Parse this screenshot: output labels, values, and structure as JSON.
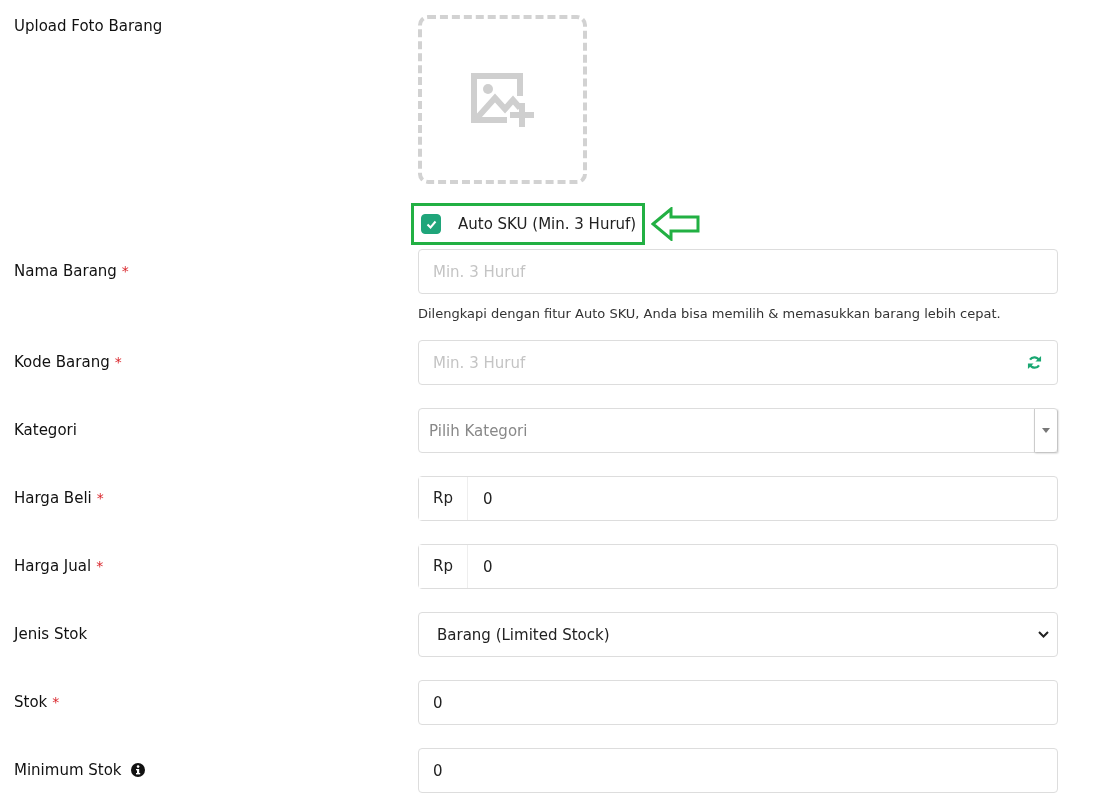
{
  "upload": {
    "label": "Upload Foto Barang"
  },
  "auto_sku": {
    "label": "Auto SKU (Min. 3 Huruf)",
    "checked": true,
    "highlighted": true
  },
  "fields": [
    {
      "kind": "text",
      "label": "Nama Barang",
      "required_mark": "*",
      "placeholder": "Min. 3 Huruf",
      "hint": "Dilengkapi dengan fitur Auto SKU, Anda bisa memilih & memasukkan barang lebih cepat."
    },
    {
      "kind": "refresh",
      "label": "Kode Barang",
      "required_mark": "*",
      "placeholder": "Min. 3 Huruf"
    },
    {
      "kind": "combo",
      "label": "Kategori",
      "placeholder": "Pilih Kategori"
    },
    {
      "kind": "money",
      "label": "Harga Beli",
      "required_mark": "*",
      "prefix": "Rp",
      "value": "0"
    },
    {
      "kind": "money",
      "label": "Harga Jual",
      "required_mark": "*",
      "prefix": "Rp",
      "value": "0"
    },
    {
      "kind": "select",
      "label": "Jenis Stok",
      "value": "Barang (Limited Stock)"
    },
    {
      "kind": "value",
      "label": "Stok",
      "required_mark": "*",
      "value": "0"
    },
    {
      "kind": "value",
      "label": "Minimum Stok",
      "info": true,
      "value": "0"
    }
  ]
}
